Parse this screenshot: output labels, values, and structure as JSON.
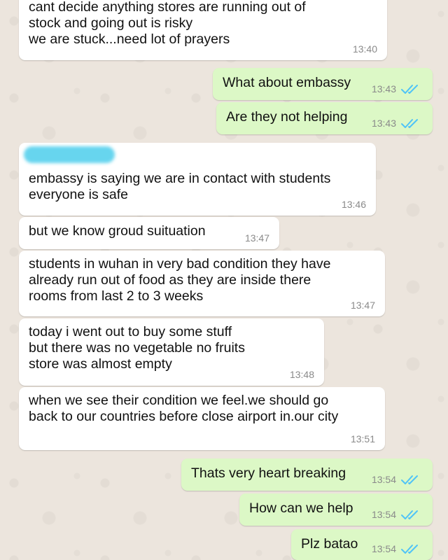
{
  "colors": {
    "wallpaper": "#ece5dd",
    "incoming_bubble": "#ffffff",
    "outgoing_bubble": "#dcf8c6",
    "read_ticks": "#4fc3f7",
    "timestamp": "#8a8a8a"
  },
  "messages": [
    {
      "direction": "in",
      "text": "cant decide anything stores are running out of\nstock and going out is risky\nwe are stuck...need lot of prayers",
      "time": "13:40"
    },
    {
      "direction": "out",
      "text": "What about embassy",
      "time": "13:43",
      "status": "read-ticks-icon"
    },
    {
      "direction": "out",
      "text": "Are they not helping",
      "time": "13:43",
      "status": "read-ticks-icon"
    },
    {
      "direction": "in",
      "text": "embassy is saying we are in contact with students\neveryone is safe",
      "time": "13:46"
    },
    {
      "direction": "in",
      "text": "but we know groud suituation",
      "time": "13:47"
    },
    {
      "direction": "in",
      "text": "students in wuhan in very bad condition they have\nalready run out of food as they are inside there\nrooms from last 2 to 3 weeks",
      "time": "13:47"
    },
    {
      "direction": "in",
      "text": "today i went out to buy some stuff\nbut there was no vegetable no fruits\nstore was almost empty",
      "time": "13:48"
    },
    {
      "direction": "in",
      "text": "when we see their condition we feel.we should go\nback to our countries before close airport in.our city",
      "time": "13:51"
    },
    {
      "direction": "out",
      "text": "Thats very heart breaking",
      "time": "13:54",
      "status": "read-ticks-icon"
    },
    {
      "direction": "out",
      "text": "How can we help",
      "time": "13:54",
      "status": "read-ticks-icon"
    },
    {
      "direction": "out",
      "text": "Plz batao",
      "time": "13:54",
      "status": "read-ticks-icon"
    }
  ]
}
